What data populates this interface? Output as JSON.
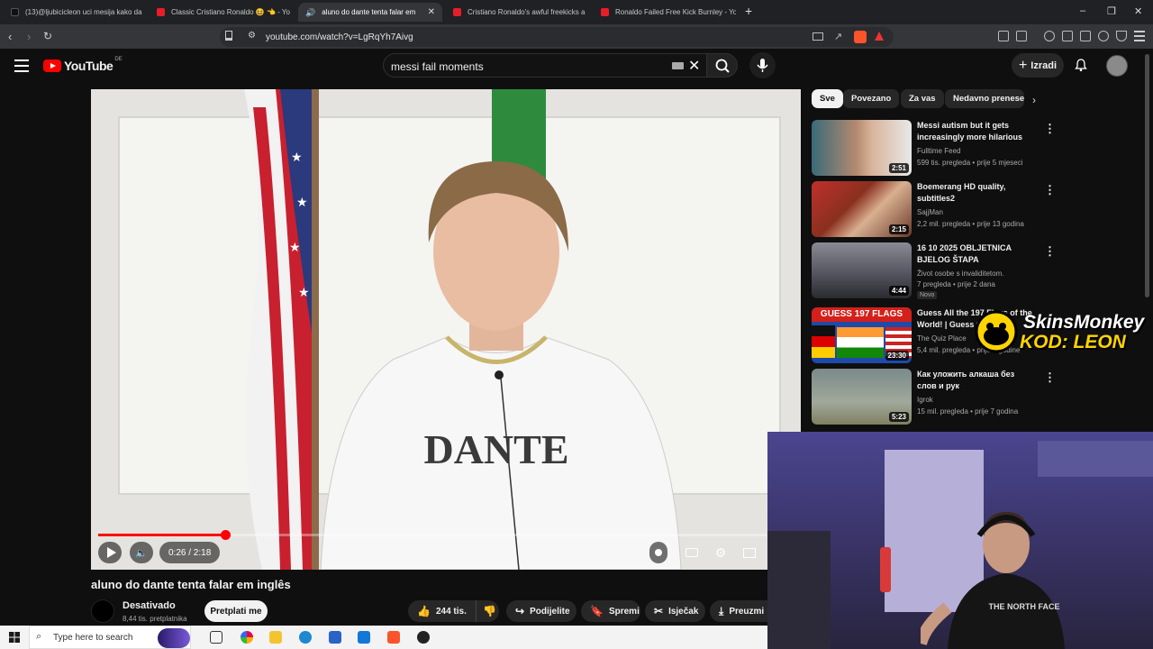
{
  "browser": {
    "tabs": [
      {
        "label": "(13)@ljubicicleon uci mesija kako da"
      },
      {
        "label": "Classic Cristiano Ronaldo 😆 👈 - Yo"
      },
      {
        "label": "aluno do dante tenta falar em"
      },
      {
        "label": "Cristiano Ronaldo's awful freekicks a"
      },
      {
        "label": "Ronaldo Failed Free Kick Burnley - Yo"
      }
    ],
    "new_tab": "+",
    "url": "youtube.com/watch?v=LgRqYh7Aivg",
    "window_controls": {
      "minimize": "–",
      "restore": "❐",
      "close": "✕"
    }
  },
  "youtube": {
    "logo_text": "YouTube",
    "region": "DE",
    "search_value": "messi fail moments",
    "create_label": "Izradi"
  },
  "player": {
    "time": "0:26 / 2:18",
    "progress_fraction": 0.19,
    "shirt_text": "DANTE"
  },
  "video": {
    "title": "aluno do dante tenta falar em inglês",
    "channel": "Desativado",
    "subscribers": "8,44 tis. pretplatnika",
    "subscribe": "Pretplati me",
    "likes": "244 tis.",
    "share": "Podijelite",
    "save": "Spremi",
    "clip": "Isječak",
    "download": "Preuzmi"
  },
  "chips": [
    "Sve",
    "Povezano",
    "Za vas",
    "Nedavno prenese"
  ],
  "recommendations": [
    {
      "title": "Messi autism but it gets increasingly more hilarious",
      "channel": "Fulltime Feed",
      "meta": "599 tis. pregleda • prije 5 mjeseci",
      "duration": "2:51",
      "badge": ""
    },
    {
      "title": "Boemerang HD quality, subtitles2",
      "channel": "SajjMan",
      "meta": "2,2 mil. pregleda • prije 13 godina",
      "duration": "2:15",
      "badge": ""
    },
    {
      "title": "16 10 2025 OBLJETNICA BJELOG ŠTAPA",
      "channel": "Život osobe s invaliditetom.",
      "meta": "7 pregleda • prije 2 dana",
      "duration": "4:44",
      "badge": "Novo"
    },
    {
      "title": "Guess All the 197 Flags of the World! | Guess the Flag",
      "channel": "The Quiz Place",
      "meta": "5,4 mil. pregleda • prije 2 godine",
      "duration": "23:30",
      "badge": "",
      "thumb_text": "GUESS 197 FLAGS"
    },
    {
      "title": "Как уложить алкаша без слов и рук",
      "channel": "Igrok",
      "meta": "15 mil. pregleda • prije 7 godina",
      "duration": "5:23",
      "badge": ""
    }
  ],
  "overlay": {
    "sponsor": "SkinsMonkey",
    "code": "KOD: LEON"
  },
  "webcam": {
    "shirt_text": "THE NORTH FACE"
  },
  "taskbar": {
    "search_placeholder": "Type here to search"
  },
  "colors": {
    "accent": "#ff0000",
    "background": "#0f0f0f",
    "sponsor_yellow": "#ffd400"
  }
}
